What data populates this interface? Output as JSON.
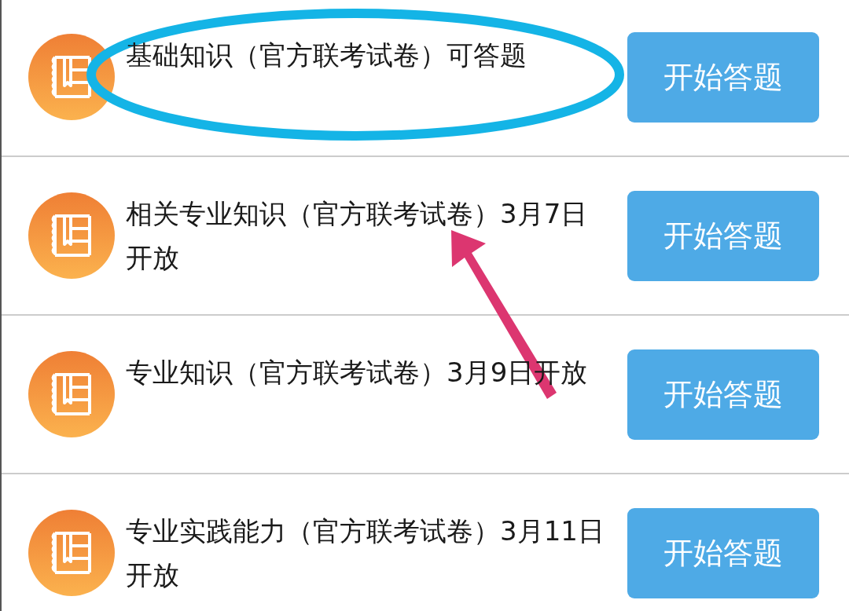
{
  "items": [
    {
      "title": "基础知识（官方联考试卷）可答题",
      "button": "开始答题"
    },
    {
      "title": "相关专业知识（官方联考试卷）3月7日开放",
      "button": "开始答题"
    },
    {
      "title": "专业知识（官方联考试卷）3月9日开放",
      "button": "开始答题"
    },
    {
      "title": "专业实践能力（官方联考试卷）3月11日开放",
      "button": "开始答题"
    }
  ],
  "annotations": [
    {
      "kind": "ellipse",
      "color": "#14b4e6"
    },
    {
      "kind": "arrow",
      "color": "#dc3670"
    }
  ]
}
